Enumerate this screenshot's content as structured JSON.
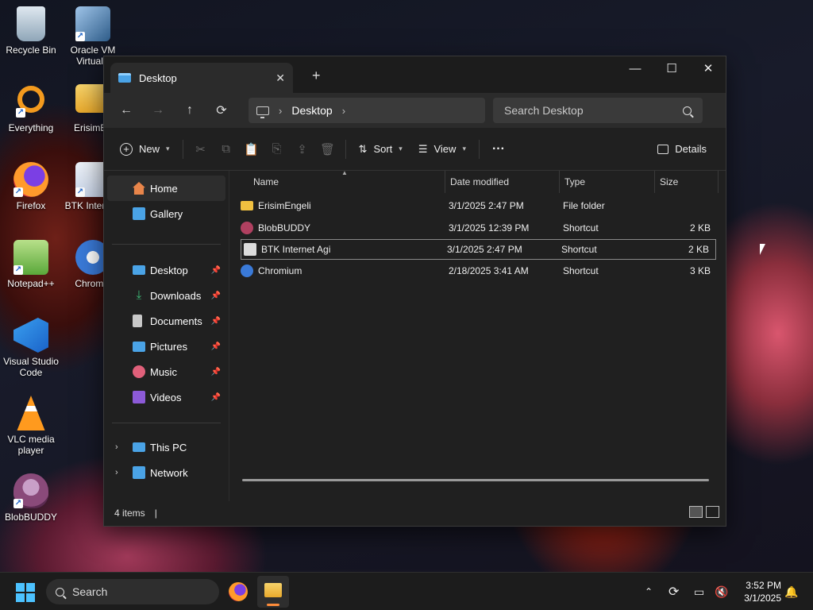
{
  "desktop_icons": [
    {
      "label": "Recycle Bin"
    },
    {
      "label": "Oracle VM VirtualB"
    },
    {
      "label": "Everything"
    },
    {
      "label": "ErisimEn"
    },
    {
      "label": "Firefox"
    },
    {
      "label": "BTK Inter Agi"
    },
    {
      "label": "Notepad++"
    },
    {
      "label": "Chromiu"
    },
    {
      "label": "Visual Studio Code"
    },
    {
      "label": "VLC media player"
    },
    {
      "label": "BlobBUDDY"
    }
  ],
  "window": {
    "tab_title": "Desktop",
    "new_tab": "+",
    "controls": {
      "minimize": "—",
      "maximize": "☐",
      "close": "✕"
    }
  },
  "addressbar": {
    "back": "←",
    "forward": "→",
    "up": "↑",
    "refresh": "⟳",
    "breadcrumb": "Desktop",
    "search_placeholder": "Search Desktop"
  },
  "toolbar": {
    "new_label": "New",
    "sort_label": "Sort",
    "view_label": "View",
    "more_label": "···",
    "details_label": "Details"
  },
  "sidebar": {
    "items": [
      {
        "label": "Home",
        "color": "#e8854a"
      },
      {
        "label": "Gallery",
        "color": "#4aa3e6"
      }
    ],
    "quick_access": [
      {
        "label": "Desktop",
        "color": "#4aa3e6"
      },
      {
        "label": "Downloads",
        "color": "#3ec07a"
      },
      {
        "label": "Documents",
        "color": "#c8c8c8"
      },
      {
        "label": "Pictures",
        "color": "#4aa3e6"
      },
      {
        "label": "Music",
        "color": "#e0607a"
      },
      {
        "label": "Videos",
        "color": "#8c5ad8"
      }
    ],
    "tree": [
      {
        "label": "This PC",
        "color": "#4aa3e6"
      },
      {
        "label": "Network",
        "color": "#4aa3e6"
      }
    ]
  },
  "columns": [
    "Name",
    "Date modified",
    "Type",
    "Size"
  ],
  "files": [
    {
      "name": "ErisimEngeli",
      "date": "3/1/2025 2:47 PM",
      "type": "File folder",
      "size": "",
      "color": "#f0c040"
    },
    {
      "name": "BlobBUDDY",
      "date": "3/1/2025 12:39 PM",
      "type": "Shortcut",
      "size": "2 KB",
      "color": "#b04060"
    },
    {
      "name": "BTK Internet Agi",
      "date": "3/1/2025 2:47 PM",
      "type": "Shortcut",
      "size": "2 KB",
      "color": "#dcdcdc"
    },
    {
      "name": "Chromium",
      "date": "2/18/2025 3:41 AM",
      "type": "Shortcut",
      "size": "3 KB",
      "color": "#3a7ad8"
    }
  ],
  "status": {
    "item_count": "4 items",
    "separator": "|"
  },
  "taskbar": {
    "search_label": "Search",
    "time": "3:52 PM",
    "date": "3/1/2025"
  }
}
